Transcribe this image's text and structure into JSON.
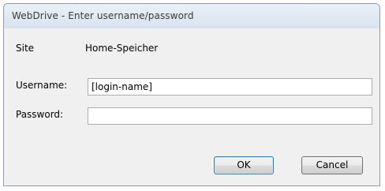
{
  "window": {
    "title": "WebDrive - Enter username/password"
  },
  "form": {
    "site_label": "Site",
    "site_value": "Home-Speicher",
    "username_label": "Username:",
    "username_value": "[login-name]",
    "password_label": "Password:",
    "password_value": ""
  },
  "buttons": {
    "ok_label": "OK",
    "cancel_label": "Cancel"
  }
}
